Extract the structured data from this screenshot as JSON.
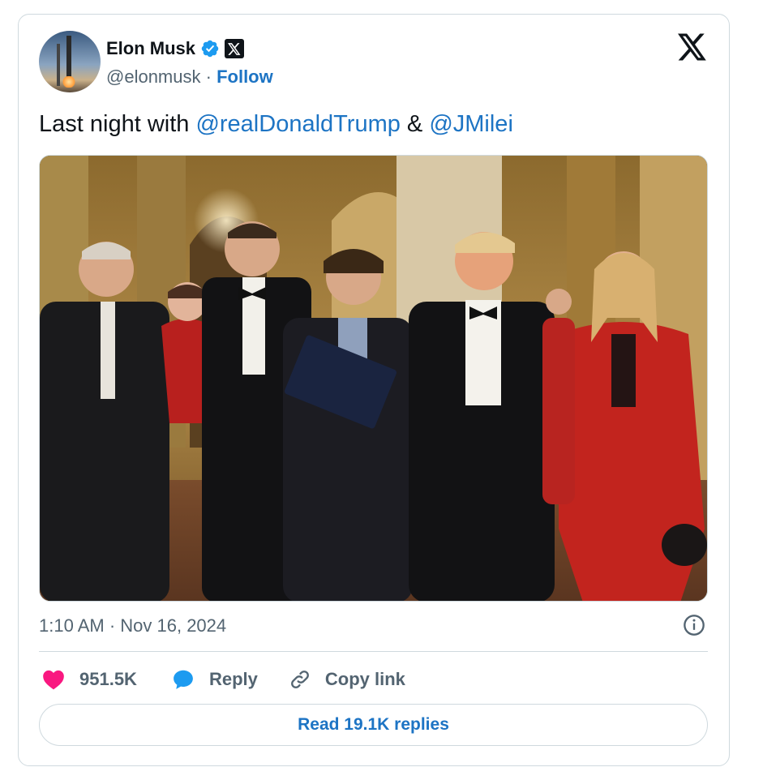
{
  "author": {
    "name": "Elon Musk",
    "handle": "@elonmusk",
    "separator": "·",
    "follow_label": "Follow"
  },
  "tweet": {
    "text_prefix": "Last night with ",
    "mention_1": "@realDonaldTrump",
    "text_middle": " & ",
    "mention_2": "@JMilei",
    "timestamp": "1:10 AM · Nov 16, 2024"
  },
  "actions": {
    "like_count": "951.5K",
    "reply_label": "Reply",
    "copy_link_label": "Copy link"
  },
  "read_replies_label": "Read 19.1K replies",
  "colors": {
    "link_blue": "#1d74c4",
    "verified_blue": "#1d9bf0",
    "like_pink": "#f91880",
    "muted_text": "#536471",
    "border": "#cfd9de"
  },
  "icons": {
    "verified": "verified-badge-icon",
    "x_badge": "x-affiliate-icon",
    "x_logo": "x-logo-icon",
    "info": "info-icon",
    "heart": "heart-icon",
    "reply": "reply-bubble-icon",
    "link": "link-icon"
  }
}
